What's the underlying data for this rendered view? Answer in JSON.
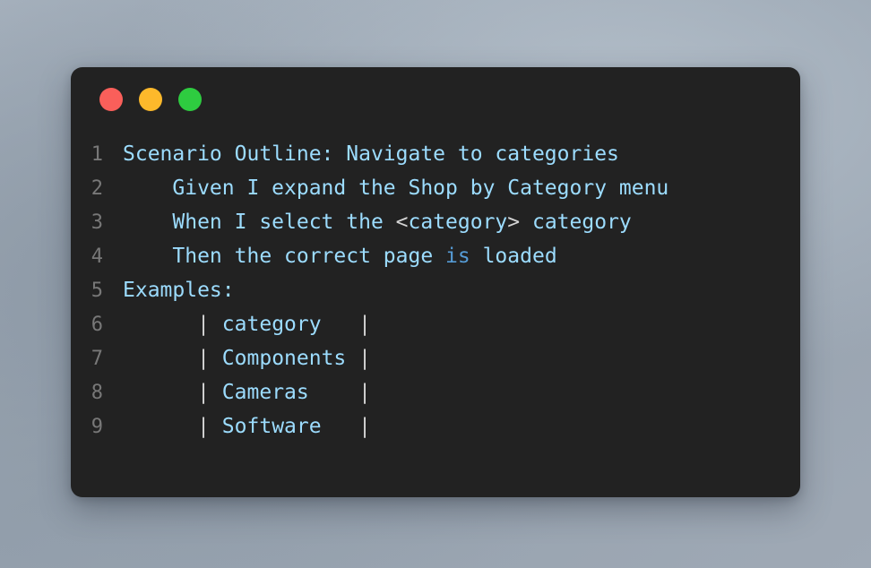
{
  "window": {
    "controls": [
      {
        "name": "close",
        "label": "Close",
        "color": "#fa5f5a"
      },
      {
        "name": "minimize",
        "label": "Minimize",
        "color": "#fdb92b"
      },
      {
        "name": "maximize",
        "label": "Maximize",
        "color": "#2ecc40"
      }
    ],
    "background": "#222222"
  },
  "theme": {
    "page_background": "#9aa6b2",
    "text": "#9cdcfe",
    "line_number": "#787878",
    "punctuation": "#d4d4d4",
    "keyword": "#569cd6"
  },
  "code": {
    "language": "gherkin",
    "lines": [
      {
        "number": "1",
        "text": "Scenario Outline: Navigate to categories"
      },
      {
        "number": "2",
        "text": "    Given I expand the Shop by Category menu"
      },
      {
        "number": "3",
        "text": "    When I select the <category> category"
      },
      {
        "number": "4",
        "text": "    Then the correct page is loaded"
      },
      {
        "number": "5",
        "text": "Examples:"
      },
      {
        "number": "6",
        "text": "      | category   |"
      },
      {
        "number": "7",
        "text": "      | Components |"
      },
      {
        "number": "8",
        "text": "      | Cameras    |"
      },
      {
        "number": "9",
        "text": "      | Software   |"
      }
    ],
    "line_numbers": [
      "1",
      "2",
      "3",
      "4",
      "5",
      "6",
      "7",
      "8",
      "9"
    ],
    "segments": [
      [
        {
          "t": "Scenario Outline: Navigate to categories",
          "c": "plain"
        }
      ],
      [
        {
          "t": "    Given I expand the Shop by Category menu",
          "c": "plain"
        }
      ],
      [
        {
          "t": "    When I select the ",
          "c": "plain"
        },
        {
          "t": "<",
          "c": "punct"
        },
        {
          "t": "category",
          "c": "plain"
        },
        {
          "t": ">",
          "c": "punct"
        },
        {
          "t": " category",
          "c": "plain"
        }
      ],
      [
        {
          "t": "    Then the correct page ",
          "c": "plain"
        },
        {
          "t": "is",
          "c": "kw"
        },
        {
          "t": " loaded",
          "c": "plain"
        }
      ],
      [
        {
          "t": "Examples:",
          "c": "plain"
        }
      ],
      [
        {
          "t": "      ",
          "c": "plain"
        },
        {
          "t": "|",
          "c": "punct"
        },
        {
          "t": " category   ",
          "c": "plain"
        },
        {
          "t": "|",
          "c": "punct"
        }
      ],
      [
        {
          "t": "      ",
          "c": "plain"
        },
        {
          "t": "|",
          "c": "punct"
        },
        {
          "t": " Components ",
          "c": "plain"
        },
        {
          "t": "|",
          "c": "punct"
        }
      ],
      [
        {
          "t": "      ",
          "c": "plain"
        },
        {
          "t": "|",
          "c": "punct"
        },
        {
          "t": " Cameras    ",
          "c": "plain"
        },
        {
          "t": "|",
          "c": "punct"
        }
      ],
      [
        {
          "t": "      ",
          "c": "plain"
        },
        {
          "t": "|",
          "c": "punct"
        },
        {
          "t": " Software   ",
          "c": "plain"
        },
        {
          "t": "|",
          "c": "punct"
        }
      ]
    ],
    "examples_table": {
      "headers": [
        "category"
      ],
      "rows": [
        [
          "Components"
        ],
        [
          "Cameras"
        ],
        [
          "Software"
        ]
      ]
    }
  }
}
